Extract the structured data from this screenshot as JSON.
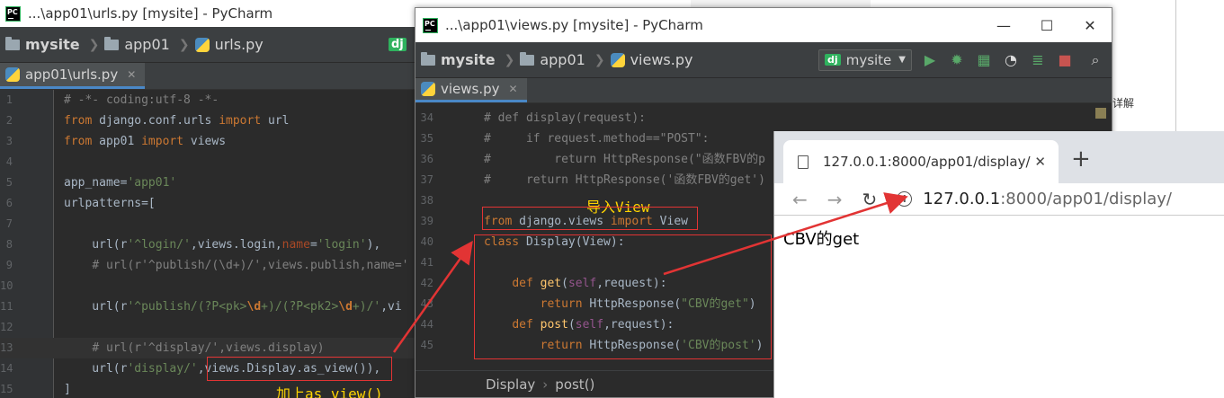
{
  "urls_window": {
    "title": "...\\app01\\urls.py [mysite] - PyCharm",
    "breadcrumb": [
      "mysite",
      "app01",
      "urls.py"
    ],
    "run_config": "dj",
    "tab": "app01\\urls.py",
    "lines": [
      {
        "n": "1",
        "html": "<span class='com'># -*- coding:utf-8 -*-</span>"
      },
      {
        "n": "2",
        "html": "<span class='kw'>from</span> django.conf.urls <span class='kw'>import</span> url"
      },
      {
        "n": "3",
        "html": "<span class='kw'>from</span> app01 <span class='kw'>import</span> views"
      },
      {
        "n": "4",
        "html": ""
      },
      {
        "n": "5",
        "html": "app_name=<span class='str'>'app01'</span>"
      },
      {
        "n": "6",
        "html": "urlpatterns=["
      },
      {
        "n": "7",
        "html": ""
      },
      {
        "n": "8",
        "html": "    url(r<span class='str'>'^login/'</span>,views.login,<span class='named'>name</span>=<span class='str'>'login'</span>),"
      },
      {
        "n": "9",
        "html": "    <span class='com'># url(r'^publish/(\\d+)/',views.publish,name='</span>"
      },
      {
        "n": "10",
        "html": ""
      },
      {
        "n": "11",
        "html": "    url(r<span class='str'>'^publish/(?P&lt;pk&gt;<span class='esc'>\\d</span>+)/(?P&lt;pk2&gt;<span class='esc'>\\d</span>+)/'</span>,vi"
      },
      {
        "n": "12",
        "html": ""
      },
      {
        "n": "13",
        "html": "    <span class='com'># url(r'^display/',views.display)</span>"
      },
      {
        "n": "14",
        "html": "    url(r<span class='str'>'display/'</span>,views.Display.as_view()),"
      },
      {
        "n": "15",
        "html": "]"
      }
    ],
    "annotation": "加上as_view()"
  },
  "views_window": {
    "title": "...\\app01\\views.py [mysite] - PyCharm",
    "breadcrumb": [
      "mysite",
      "app01",
      "views.py"
    ],
    "run_config": "mysite",
    "run_config_badge": "dj",
    "tab": "views.py",
    "lines": [
      {
        "n": "34",
        "html": "<span class='com'># def display(request):</span>"
      },
      {
        "n": "35",
        "html": "<span class='com'>#     if request.method==\"POST\":</span>"
      },
      {
        "n": "36",
        "html": "<span class='com'>#         return HttpResponse(\"函数FBV的p</span>"
      },
      {
        "n": "37",
        "html": "<span class='com'>#     return HttpResponse('函数FBV的get')</span>"
      },
      {
        "n": "38",
        "html": ""
      },
      {
        "n": "39",
        "html": "<span class='kw'>from</span> django.views <span class='kw'>import</span> View"
      },
      {
        "n": "40",
        "html": "<span class='kw'>class</span> Display(View):"
      },
      {
        "n": "41",
        "html": ""
      },
      {
        "n": "42",
        "html": "    <span class='kw'>def</span> <span class='fn'>get</span>(<span class='self'>self</span>,request):"
      },
      {
        "n": "43",
        "html": "        <span class='kw'>return</span> HttpResponse(<span class='str'>\"CBV的get\"</span>)"
      },
      {
        "n": "44",
        "html": "    <span class='kw'>def</span> <span class='fn'>post</span>(<span class='self'>self</span>,request):"
      },
      {
        "n": "45",
        "html": "        <span class='kw'>return</span> HttpResponse(<span class='str'>'CBV的post'</span>)"
      }
    ],
    "annotation": "导入View",
    "footer_breadcrumb": [
      "Display",
      "post()"
    ],
    "window_buttons": [
      "—",
      "☐",
      "✕"
    ]
  },
  "browser": {
    "tab_title": "127.0.0.1:8000/app01/display/",
    "url_host": "127.0.0.1",
    "url_rest": ":8000/app01/display/",
    "body_text": "CBV的get"
  },
  "background": {
    "snippet": "详解"
  },
  "colors": {
    "annotation": "#ffd400",
    "highlight_box": "#e23434",
    "editor_bg": "#2b2b2b"
  }
}
